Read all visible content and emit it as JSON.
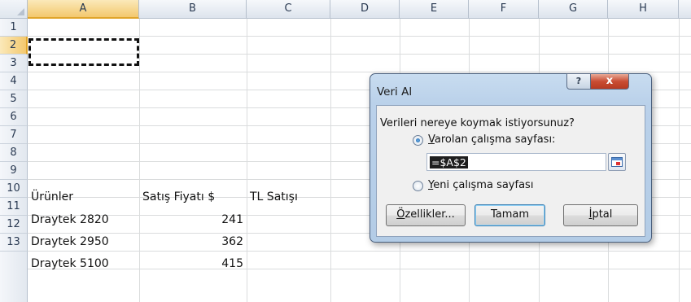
{
  "spreadsheet": {
    "columns": [
      "A",
      "B",
      "C",
      "D",
      "E",
      "F",
      "G",
      "H"
    ],
    "rows": [
      "1",
      "2",
      "3",
      "4",
      "5",
      "6",
      "7",
      "8",
      "9",
      "10",
      "11",
      "12",
      "13"
    ],
    "selected_column": "A",
    "selected_row": "2",
    "cells": {
      "A9": "Ürünler",
      "B9": "Satış Fiyatı $",
      "C9": "TL Satışı",
      "A10": "Draytek 2820",
      "B10": "241",
      "A11": "Draytek 2950",
      "B11": "362",
      "A12": "Draytek 5100",
      "B12": "415"
    }
  },
  "dialog": {
    "title": "Veri Al",
    "help_symbol": "?",
    "close_symbol": "x",
    "question": "Verileri nereye koymak istiyorsunuz?",
    "option_existing": {
      "mnemonic": "V",
      "rest": "arolan çalışma sayfası:",
      "selected": true
    },
    "reference_value": "=$A$2",
    "option_new": {
      "mnemonic": "Y",
      "rest": "eni çalışma sayfası",
      "selected": false
    },
    "properties_button": {
      "mnemonic": "Ö",
      "rest": "zellikler..."
    },
    "ok_button": "Tamam",
    "cancel_button": {
      "mnemonic": "İ",
      "rest": "ptal"
    }
  },
  "icons": [
    "corner-select-all-icon",
    "radio-selected-icon",
    "radio-unselected-icon",
    "collapse-dialog-icon",
    "help-icon",
    "close-icon"
  ]
}
